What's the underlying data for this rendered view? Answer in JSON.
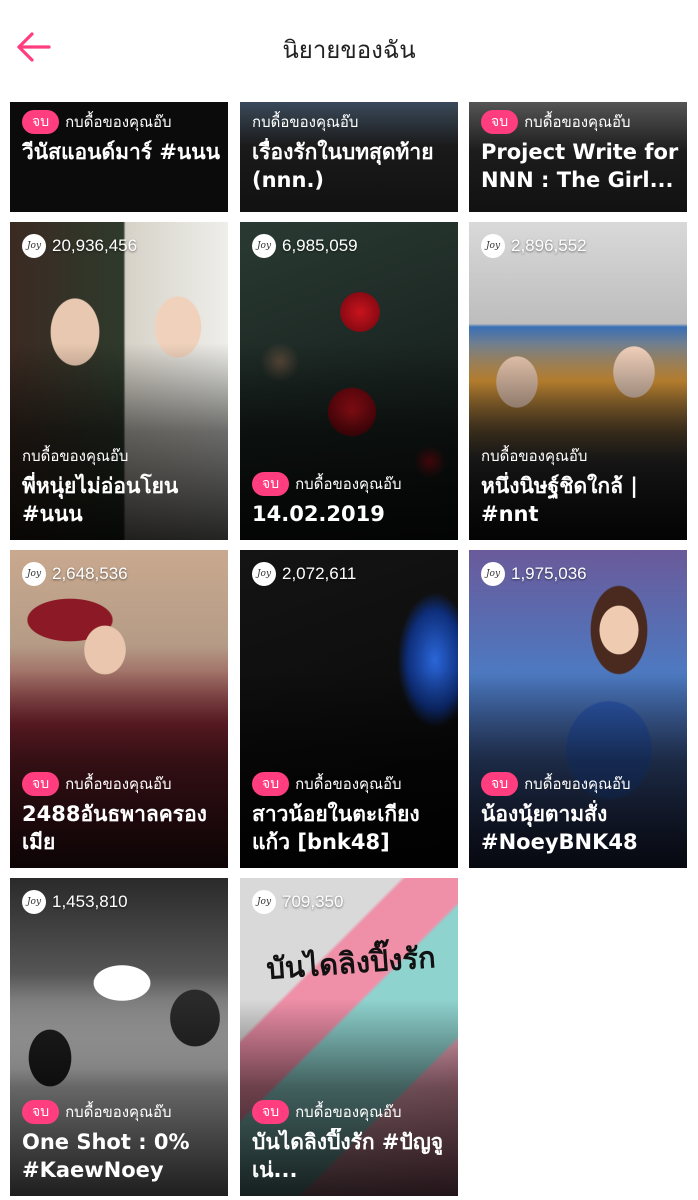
{
  "header": {
    "title": "นิยายของฉัน",
    "back_icon": "arrow-left-icon",
    "accent": "#ff3d7f"
  },
  "badge_label": "จบ",
  "novels": [
    {
      "title": "วีนัสแอนด์มาร์ #นนน",
      "author": "กบดื้อของคุณอ๊บ",
      "completed": true,
      "views": ""
    },
    {
      "title": "เรื่องรักในบทสุดท้าย (nnn.)",
      "author": "กบดื้อของคุณอ๊บ",
      "completed": false,
      "views": ""
    },
    {
      "title": "Project Write for NNN : The Girl...",
      "author": "กบดื้อของคุณอ๊บ",
      "completed": true,
      "views": ""
    },
    {
      "title": "พี่หนุ่ยไม่อ่อนโยน #นนน",
      "author": "กบดื้อของคุณอ๊บ",
      "completed": false,
      "views": "20,936,456"
    },
    {
      "title": "14.02.2019",
      "author": "กบดื้อของคุณอ๊บ",
      "completed": true,
      "views": "6,985,059"
    },
    {
      "title": "หนึ่งนิษฐ์ชิดใกล้ | #nnt",
      "author": "กบดื้อของคุณอ๊บ",
      "completed": false,
      "views": "2,896,552"
    },
    {
      "title": "2488อันธพาลครองเมีย",
      "author": "กบดื้อของคุณอ๊บ",
      "completed": true,
      "views": "2,648,536"
    },
    {
      "title": "สาวน้อยในตะเกียงแก้ว [bnk48]",
      "author": "กบดื้อของคุณอ๊บ",
      "completed": true,
      "views": "2,072,611"
    },
    {
      "title": "น้องนุ้ยตามสั่ง #NoeyBNK48",
      "author": "กบดื้อของคุณอ๊บ",
      "completed": true,
      "views": "1,975,036"
    },
    {
      "title": "One Shot : 0% #KaewNoey",
      "author": "กบดื้อของคุณอ๊บ",
      "completed": true,
      "views": "1,453,810"
    },
    {
      "title": "บันไดลิงปิ๊งรัก #ปัญจูเน่...",
      "author": "กบดื้อของคุณอ๊บ",
      "completed": true,
      "views": "709,350"
    }
  ],
  "cover_art_texts": {
    "n10": "บันไดลิงปิ๊งรัก"
  },
  "views_icon": "joy-icon"
}
